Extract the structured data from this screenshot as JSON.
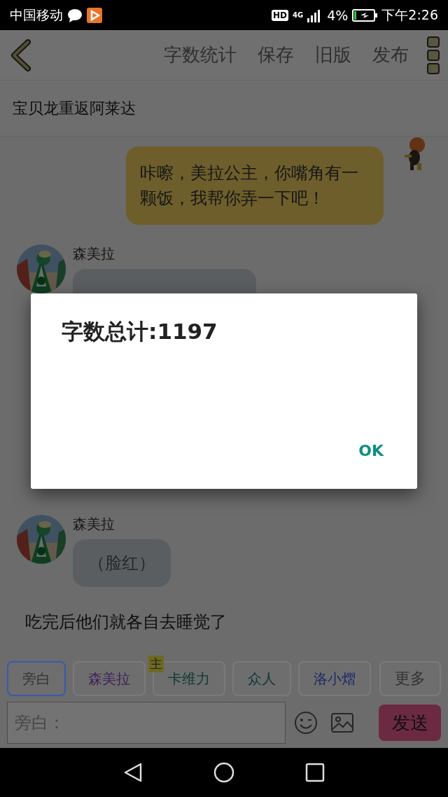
{
  "status_bar": {
    "carrier": "中国移动",
    "hd": "HD",
    "network": "4G",
    "battery": "4%",
    "time": "下午2:26"
  },
  "toolbar": {
    "actions": [
      "字数统计",
      "保存",
      "旧版",
      "发布"
    ]
  },
  "title": "宝贝龙重返阿莱达",
  "messages": [
    {
      "kind": "right",
      "text": "咔嚓，美拉公主，你嘴角有一颗饭，我帮你弄一下吧！"
    },
    {
      "kind": "left",
      "name": "森美拉"
    },
    {
      "kind": "left",
      "name": "森美拉",
      "text": "（脸红）"
    },
    {
      "kind": "narration",
      "text": "吃完后他们就各自去睡觉了"
    }
  ],
  "roles": [
    {
      "label": "旁白",
      "selected": true,
      "color": "#333333"
    },
    {
      "label": "森美拉",
      "selected": false,
      "color": "#40205a"
    },
    {
      "label": "卡维力",
      "selected": false,
      "color": "#0a3a30",
      "badge": "主"
    },
    {
      "label": "众人",
      "selected": false,
      "color": "#0a3832"
    },
    {
      "label": "洛小熠",
      "selected": false,
      "color": "#1a2a6a"
    }
  ],
  "more": "更多",
  "input": {
    "placeholder": "旁白："
  },
  "send": "发送",
  "dialog": {
    "message": "字数总计:1197",
    "button": "OK"
  }
}
